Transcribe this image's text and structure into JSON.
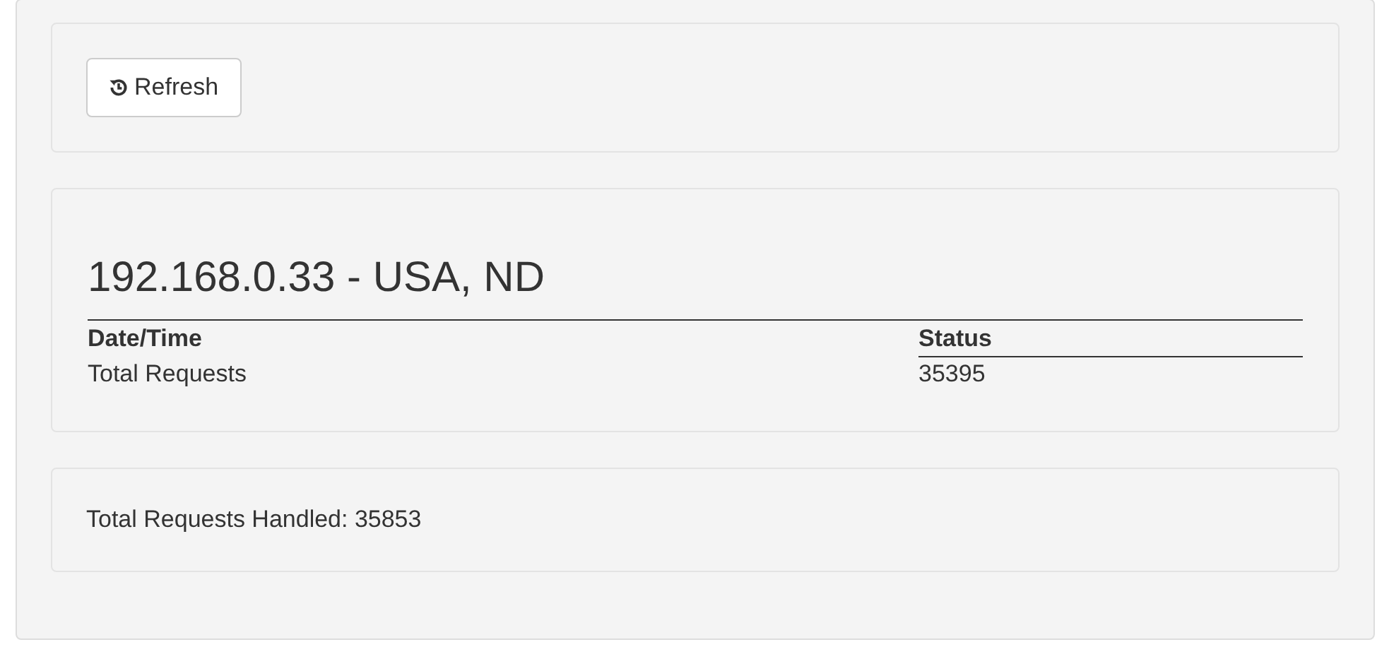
{
  "refresh_button": {
    "label": "Refresh"
  },
  "host_panel": {
    "title": "192.168.0.33 - USA, ND",
    "table": {
      "columns": [
        "Date/Time",
        "Status"
      ],
      "rows": [
        [
          "Total Requests",
          "35395"
        ]
      ]
    }
  },
  "summary": {
    "text": "Total Requests Handled: 35853"
  }
}
